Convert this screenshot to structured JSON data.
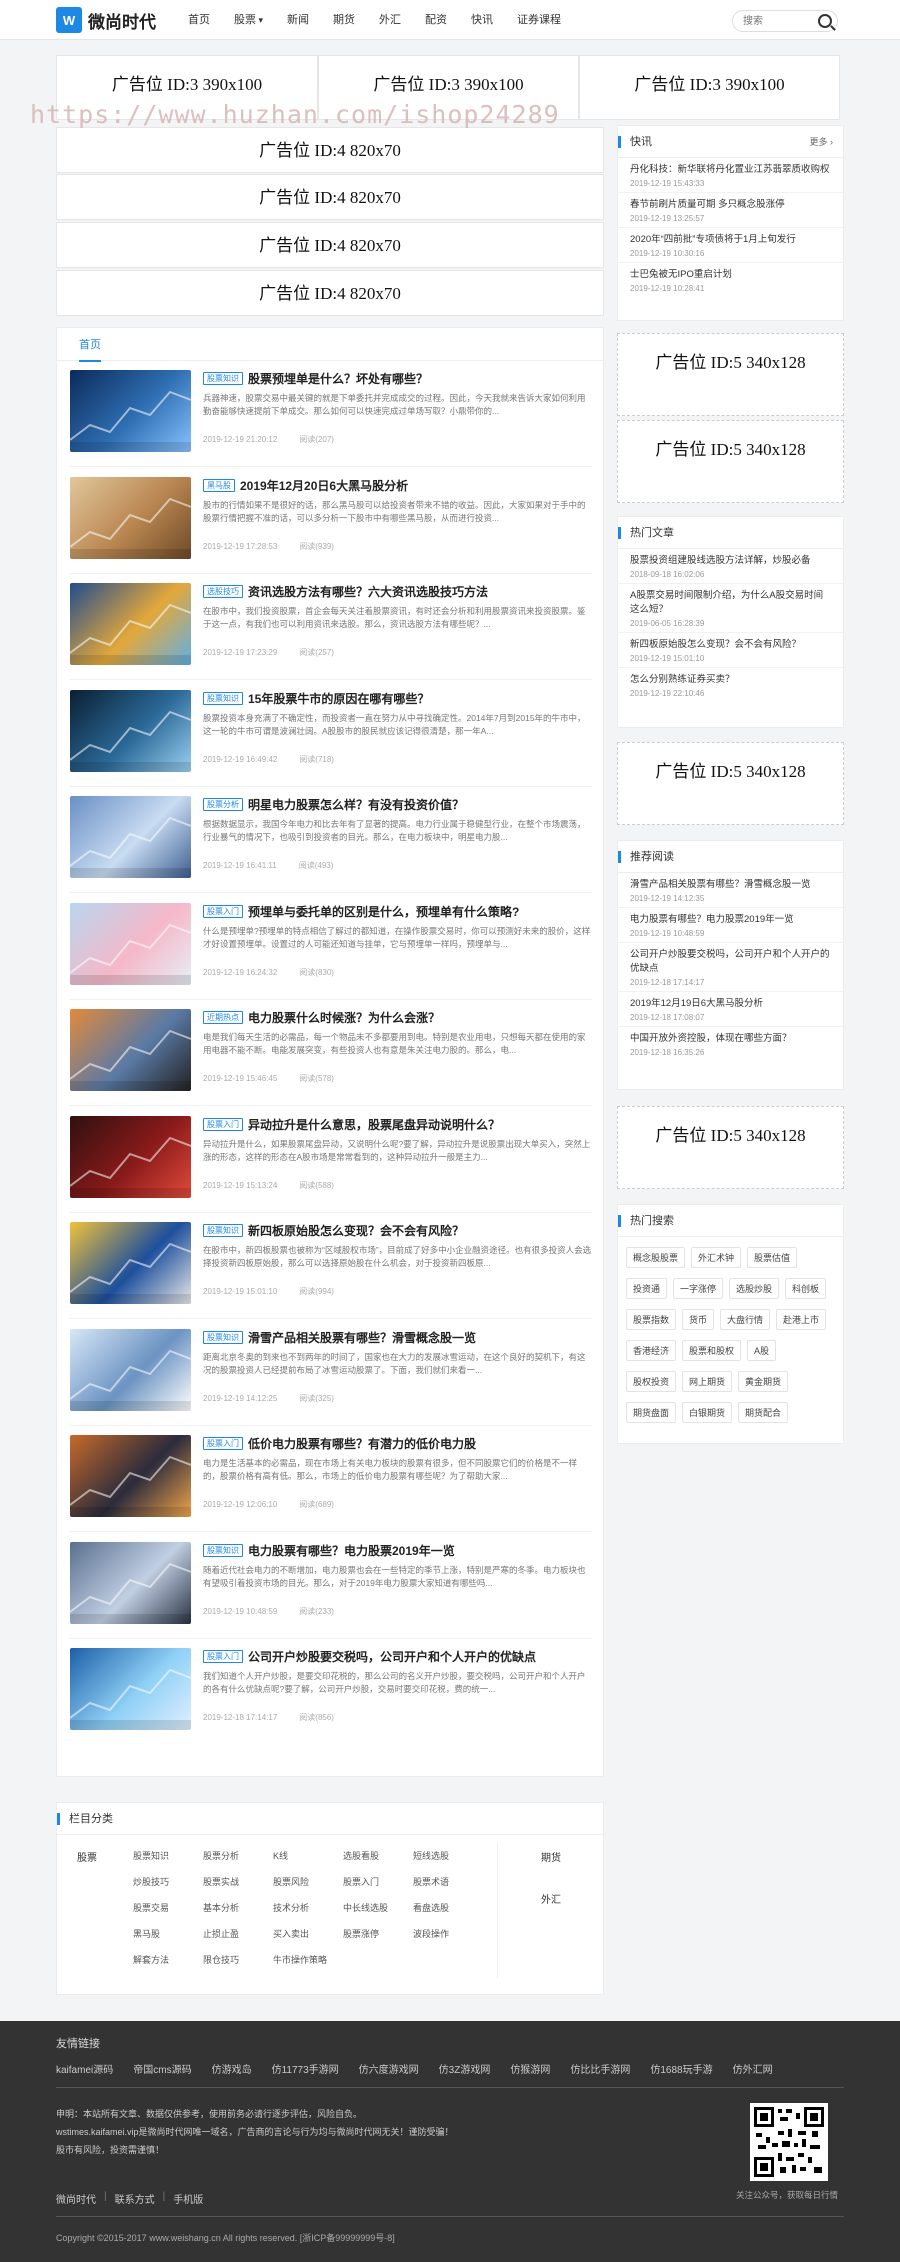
{
  "header": {
    "logo_mark": "W",
    "logo_text": "微尚时代",
    "nav": [
      "首页",
      "股票",
      "新闻",
      "期货",
      "外汇",
      "配资",
      "快讯",
      "证券课程"
    ],
    "search_placeholder": "搜索"
  },
  "watermark": "https://www.huzhan.com/ishop24289",
  "ads": {
    "id3": "广告位 ID:3 390x100",
    "id4": "广告位 ID:4 820x70",
    "id5": "广告位 ID:5 340x128"
  },
  "main": {
    "tab": "首页",
    "articles": [
      {
        "cat": "股票知识",
        "title": "股票预埋单是什么？坏处有哪些？",
        "summary": "兵器神速，股票交易中最关键的就是下单委托并完成成交的过程。因此，今天我就来告诉大家如何利用勤奋能够快速提前下单成交。那么如何可以快速完成过单场写取？小鼎带你的...",
        "date": "2019-12-19 21:20:12",
        "read": "阅读(207)"
      },
      {
        "cat": "黑马股",
        "title": "2019年12月20日6大黑马股分析",
        "summary": "股市的行情如果不是很好的话，那么黑马股可以给投资者带来不错的收益。因此，大家如果对于手中的股票行情把握不准的话，可以多分析一下股市中有哪些黑马股，从而进行投资...",
        "date": "2019-12-19 17:28:53",
        "read": "阅读(939)"
      },
      {
        "cat": "选股技巧",
        "title": "资讯选股方法有哪些？六大资讯选股技巧方法",
        "summary": "在股市中，我们投资股票，首企会每天关注着股票资讯，有时还会分析和利用股票资讯来投资股票。鉴于这一点，有我们也可以利用资讯来选股。那么，资讯选股方法有哪些呢？...",
        "date": "2019-12-19 17:23:29",
        "read": "阅读(257)"
      },
      {
        "cat": "股票知识",
        "title": "15年股票牛市的原因在哪有哪些？",
        "summary": "股票投资本身充满了不确定性，而投资者一直在努力从中寻找确定性。2014年7月到2015年的牛市中，这一轮的牛市可谓是波澜壮阔。A股股市的股民就应该记得很清楚，那一年A...",
        "date": "2019-12-19 16:49:42",
        "read": "阅读(718)"
      },
      {
        "cat": "股票分析",
        "title": "明星电力股票怎么样？有没有投资价值？",
        "summary": "根据数据显示，我国今年电力和比去年有了显著的提高。电力行业属于稳健型行业，在整个市场震荡，行业暴气的情况下，也吸引到投资者的目光。那么，在电力板块中，明星电力股...",
        "date": "2019-12-19 16:41:11",
        "read": "阅读(493)"
      },
      {
        "cat": "股票入门",
        "title": "预埋单与委托单的区别是什么，预埋单有什么策略?",
        "summary": "什么是预埋单?预埋单的特点相信了解过的都知道，在操作股票交易时，你可以预测好未来的股价，这样才好设置预埋单。设置过的人可能还知道与挂单，它与预埋单一样吗，预埋单与...",
        "date": "2019-12-19 16:24:32",
        "read": "阅读(830)"
      },
      {
        "cat": "近期热点",
        "title": "电力股票什么时候涨？为什么会涨？",
        "summary": "电是我们每天生活的必需品，每一个物品未不多都要用到电。特别是农业用电，只想每天都在使用的家用电器不能不断。电能发展突变，有些投资人也有意是朱关注电力股的。那么，电...",
        "date": "2019-12-19 15:46:45",
        "read": "阅读(578)"
      },
      {
        "cat": "股票入门",
        "title": "异动拉升是什么意思，股票尾盘异动说明什么？",
        "summary": "异动拉升是什么，如果股票尾盘异动，又说明什么呢?要了解，异动拉升是说股票出现大单买入，突然上涨的形态，这样的形态在A股市场是常常看到的，这种异动拉升一般是主力...",
        "date": "2019-12-19 15:13:24",
        "read": "阅读(588)"
      },
      {
        "cat": "股票知识",
        "title": "新四板原始股怎么变现？会不会有风险？",
        "summary": "在股市中，新四板股票也被称为“区域股权市场”，目前成了好多中小企业融资途径。也有很多投资人会选择投资新四板原始股，那么可以选择原始股在什么机会，对于投资新四板原...",
        "date": "2019-12-19 15:01:10",
        "read": "阅读(994)"
      },
      {
        "cat": "股票知识",
        "title": "滑雪产品相关股票有哪些？滑雪概念股一览",
        "summary": "距离北京冬奥的到来也不到两年的时间了，国家也在大力的发展冰雪运动，在这个良好的契机下，有这况的股票投资人已经提前布局了冰雪运动股票了。下面，我们就们来看一...",
        "date": "2019-12-19 14:12:25",
        "read": "阅读(325)"
      },
      {
        "cat": "股票入门",
        "title": "低价电力股票有哪些？有潜力的低价电力股",
        "summary": "电力是生活基本的必需品，现在市场上有关电力板块的股票有很多，但不同股票它们的价格是不一样的，股票价格有高有低。那么，市场上的低价电力股票有哪些呢？为了帮助大家...",
        "date": "2019-12-19 12:06:10",
        "read": "阅读(689)"
      },
      {
        "cat": "股票知识",
        "title": "电力股票有哪些？电力股票2019年一览",
        "summary": "随着近代社会电力的不断增加，电力股票也会在一些特定的季节上涨，特别是严寒的冬季。电力板块也有望吸引着投资市场的目光。那么，对于2019年电力股票大家知道有哪些吗...",
        "date": "2019-12-19 10:48:59",
        "read": "阅读(233)"
      },
      {
        "cat": "股票入门",
        "title": "公司开户炒股要交税吗，公司开户和个人开户的优缺点",
        "summary": "我们知道个人开户炒股，是要交印花税的，那么公司的名义开户炒股，要交税吗，公司开户和个人开户的各有什么优缺点呢?要了解，公司开户炒股，交易时要交印花税，费的统一...",
        "date": "2019-12-18 17:14:17",
        "read": "阅读(856)"
      }
    ]
  },
  "sidebar": {
    "flash": {
      "title": "快讯",
      "more": "更多",
      "items": [
        {
          "t": "丹化科技：新华联将丹化置业江苏翡翠质收购权",
          "d": "2019-12-19 15:43:33"
        },
        {
          "t": "春节前刷片质量可期 多只概念股涨停",
          "d": "2019-12-19 13:25:57"
        },
        {
          "t": "2020年“四前批”专项债将于1月上旬发行",
          "d": "2019-12-19 10:30:16"
        },
        {
          "t": "士巴兔被无IPO重启计划",
          "d": "2019-12-19 10:28:41"
        }
      ]
    },
    "hot": {
      "title": "热门文章",
      "items": [
        {
          "t": "股票投资组建股线选股方法详解，炒股必备",
          "d": "2018-09-18 16:02:06"
        },
        {
          "t": "A股票交易时间限制介绍，为什么A股交易时间这么短？",
          "d": "2019-06-05 16:28:39"
        },
        {
          "t": "新四板原始股怎么变现？会不会有风险？",
          "d": "2019-12-19 15:01:10"
        },
        {
          "t": "怎么分别熟练证券买卖？",
          "d": "2019-12-19 22:10:46"
        }
      ]
    },
    "rec": {
      "title": "推荐阅读",
      "items": [
        {
          "t": "滑雪产品相关股票有哪些？滑雪概念股一览",
          "d": "2019-12-19 14:12:35"
        },
        {
          "t": "电力股票有哪些？电力股票2019年一览",
          "d": "2019-12-19 10:48:59"
        },
        {
          "t": "公司开户炒股要交税吗，公司开户和个人开户的优缺点",
          "d": "2019-12-18 17:14:17"
        },
        {
          "t": "2019年12月19日6大黑马股分析",
          "d": "2019-12-18 17:08:07"
        },
        {
          "t": "中国开放外资控股，体现在哪些方面？",
          "d": "2019-12-18 16:35:26"
        }
      ]
    },
    "tags": {
      "title": "热门搜索",
      "items": [
        "概念股股票",
        "外汇术钟",
        "股票估值",
        "投资通",
        "一字涨停",
        "选股炒股",
        "科创板",
        "股票指数",
        "货币",
        "大盘行情",
        "赴港上市",
        "香港经济",
        "股票和股权",
        "A股",
        "股权投资",
        "网上期货",
        "黄金期货",
        "期货盘面",
        "白银期货",
        "期货配合"
      ]
    }
  },
  "categories": {
    "title": "栏目分类",
    "main_label": "股票",
    "items": [
      "股票知识",
      "股票分析",
      "K线",
      "选股看股",
      "短线选股",
      "炒股技巧",
      "股票实战",
      "股票风险",
      "股票入门",
      "股票术语",
      "股票交易",
      "基本分析",
      "技术分析",
      "中长线选股",
      "看盘选股",
      "黑马股",
      "止损止盈",
      "买入卖出",
      "股票涨停",
      "波段操作",
      "解套方法",
      "限仓技巧",
      "牛市操作策略"
    ],
    "side": [
      "期货",
      "外汇"
    ]
  },
  "footer": {
    "links_title": "友情链接",
    "links": [
      "kaifamei源码",
      "帝国cms源码",
      "仿游戏岛",
      "仿11773手游网",
      "仿六度游戏网",
      "仿3Z游戏网",
      "仿猴游网",
      "仿比比手游网",
      "仿1688玩手游",
      "仿外汇网"
    ],
    "notice": [
      "申明：本站所有文章、数据仅供参考，使用前务必请行逐步评估，风险自负。",
      "wstimes.kaifamei.vip是微尚时代网唯一域名，广告商的言论与行为均与微尚时代网无关！谨防受骗！",
      "股市有风险，投资需谨慎！"
    ],
    "qr_caption": "关注公众号，获取每日行情",
    "nav": [
      "微尚时代",
      "联系方式",
      "手机版"
    ],
    "copyright": "Copyright ©2015-2017 www.weishang.cn All rights reserved. [浙ICP备99999999号-8]"
  }
}
